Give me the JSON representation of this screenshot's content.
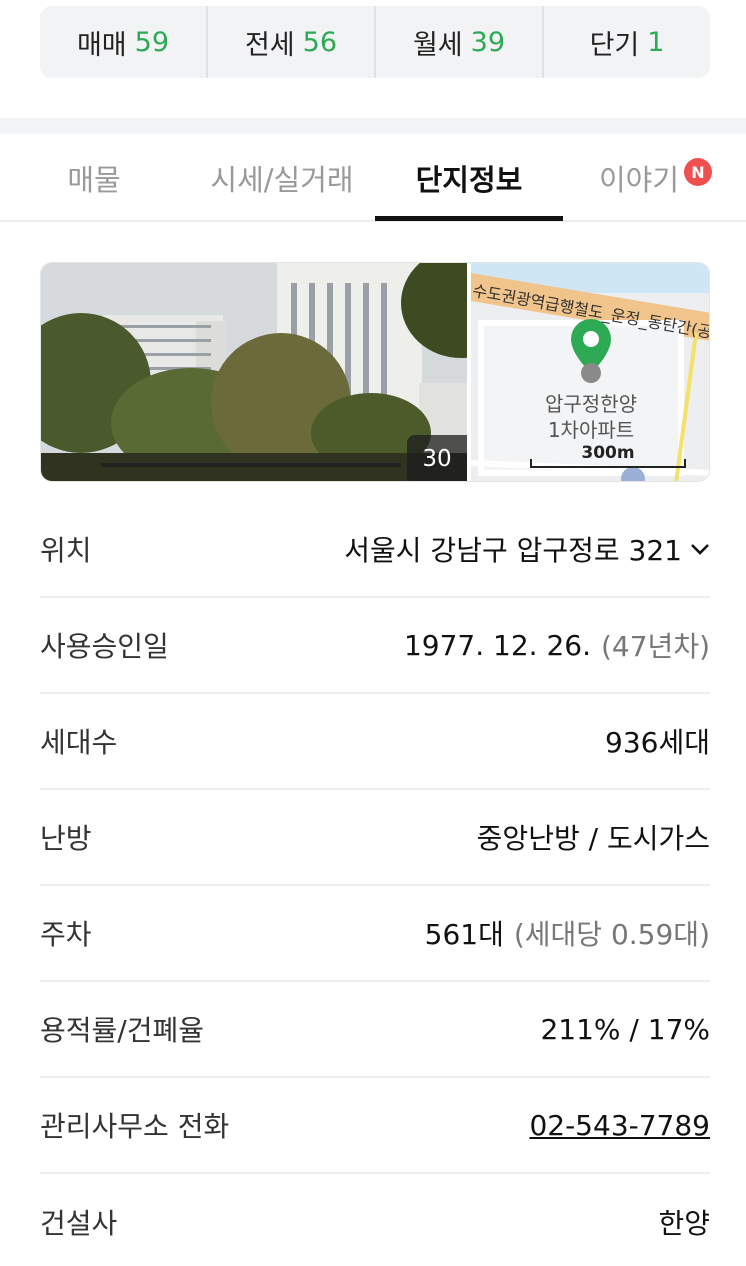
{
  "trade_bar": [
    {
      "label": "매매",
      "count": "59"
    },
    {
      "label": "전세",
      "count": "56"
    },
    {
      "label": "월세",
      "count": "39"
    },
    {
      "label": "단기",
      "count": "1"
    }
  ],
  "tabs": [
    {
      "label": "매물"
    },
    {
      "label": "시세/실거래"
    },
    {
      "label": "단지정보",
      "active": true
    },
    {
      "label": "이야기",
      "badge": "N"
    }
  ],
  "media": {
    "photo_count": "30",
    "map_road_label": "수도권광역급행철도_운정_동탄간(공사중)",
    "map_place_name_line1": "압구정한양",
    "map_place_name_line2": "1차아파트",
    "map_scale": "300m",
    "colors": {
      "pin": "#2eaa55",
      "road": "#f0c48a"
    }
  },
  "info": {
    "location": {
      "label": "위치",
      "value": "서울시 강남구 압구정로 321"
    },
    "approval_date": {
      "label": "사용승인일",
      "value": "1977. 12. 26.",
      "sub": "(47년차)"
    },
    "households": {
      "label": "세대수",
      "value": "936세대"
    },
    "heating": {
      "label": "난방",
      "value": "중앙난방 / 도시가스"
    },
    "parking": {
      "label": "주차",
      "value": "561대",
      "sub": "(세대당 0.59대)"
    },
    "far_bcr": {
      "label": "용적률/건폐율",
      "value": "211% / 17%"
    },
    "office_phone": {
      "label": "관리사무소 전화",
      "value": "02-543-7789"
    },
    "builder": {
      "label": "건설사",
      "value": "한양"
    }
  },
  "colors": {
    "accent_green": "#2eaa55",
    "badge_red": "#f04f4f"
  }
}
